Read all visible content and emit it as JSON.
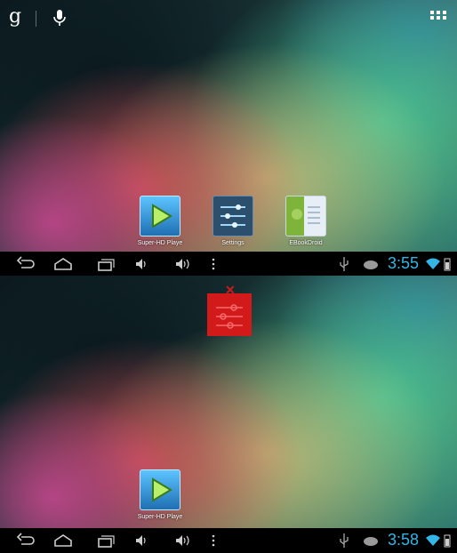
{
  "screens": [
    {
      "apps": [
        {
          "label": "Super-HD Playe",
          "icon": "video-player-icon"
        },
        {
          "label": "Settings",
          "icon": "settings-icon"
        },
        {
          "label": "EBookDroid",
          "icon": "ebook-reader-icon"
        }
      ],
      "status": {
        "time": "3:55"
      }
    },
    {
      "apps": [
        {
          "label": "Super-HD Playe",
          "icon": "video-player-icon"
        }
      ],
      "remove_target": {
        "icon": "remove-trash-icon"
      },
      "status": {
        "time": "3:58"
      }
    }
  ],
  "search": {
    "logo": "g"
  },
  "colors": {
    "accent": "#33b5e5",
    "remove": "#d21a1a"
  }
}
